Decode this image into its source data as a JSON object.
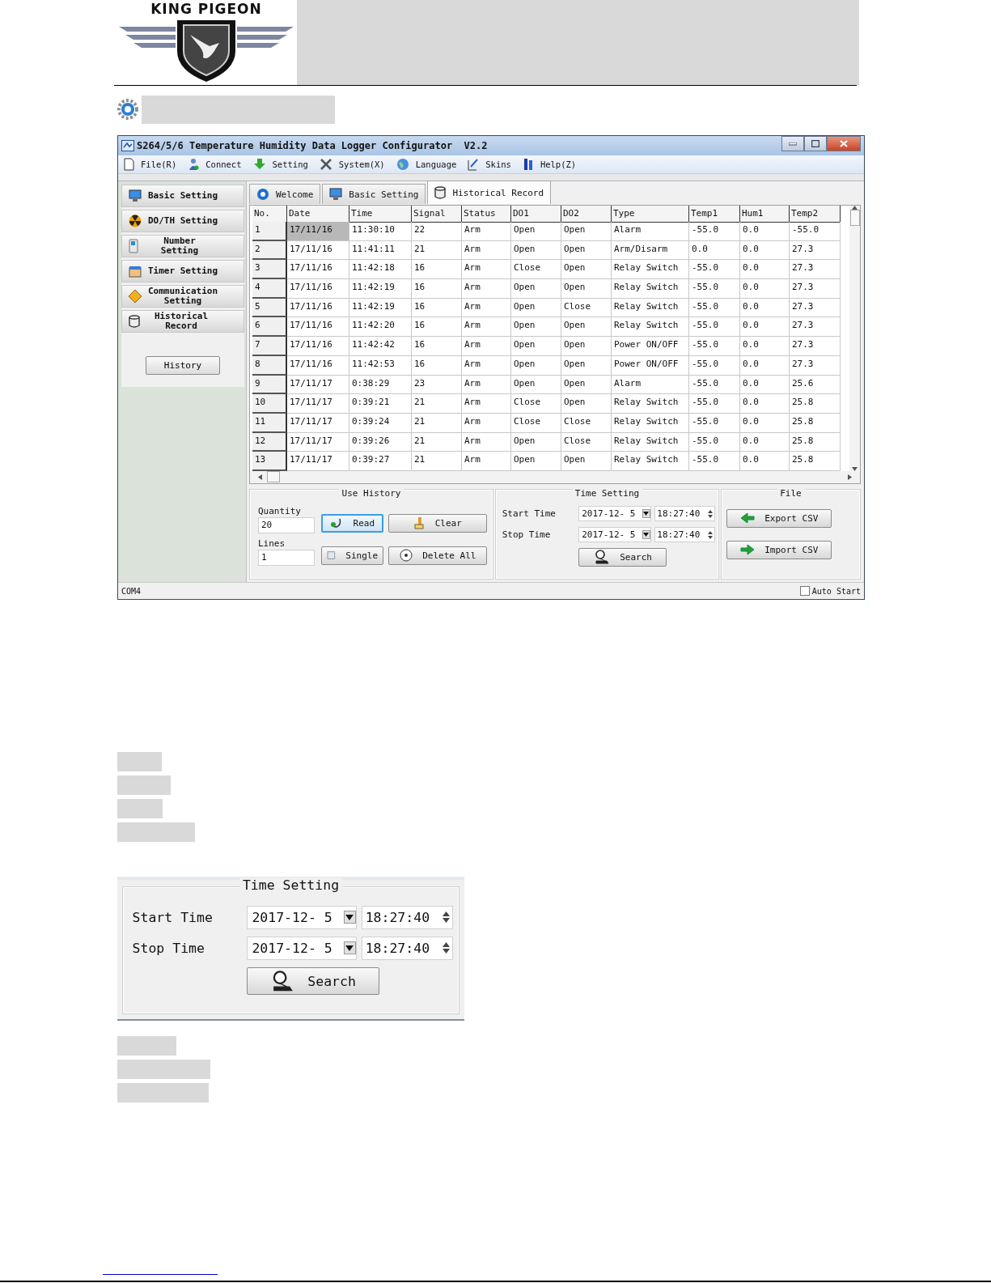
{
  "header": {
    "logo_text": "KING PIGEON"
  },
  "window": {
    "title": "S264/5/6 Temperature Humidity Data Logger Configurator  V2.2",
    "menu": [
      "File(R)",
      "Connect",
      "Setting",
      "System(X)",
      "Language",
      "Skins",
      "Help(Z)"
    ],
    "sidebar": {
      "items": [
        {
          "label": "Basic Setting"
        },
        {
          "label": "DO/TH Setting"
        },
        {
          "label": "Number Setting"
        },
        {
          "label": "Timer Setting"
        },
        {
          "label": "Communication Setting"
        },
        {
          "label": "Historical Record"
        }
      ],
      "history_button": "History"
    },
    "tabs": [
      {
        "label": "Welcome",
        "selected": false
      },
      {
        "label": "Basic Setting",
        "selected": false
      },
      {
        "label": "Historical Record",
        "selected": true
      }
    ],
    "table": {
      "columns": [
        "No.",
        "Date",
        "Time",
        "Signal",
        "Status",
        "DO1",
        "DO2",
        "Type",
        "Temp1",
        "Hum1",
        "Temp2"
      ],
      "rows": [
        {
          "selected": true,
          "cells": [
            "1",
            "17/11/16",
            "11:30:10",
            "22",
            "Arm",
            "Open",
            "Open",
            "Alarm",
            "-55.0",
            "0.0",
            "-55.0"
          ]
        },
        {
          "selected": false,
          "cells": [
            "2",
            "17/11/16",
            "11:41:11",
            "21",
            "Arm",
            "Open",
            "Open",
            "Arm/Disarm",
            "0.0",
            "0.0",
            "27.3"
          ]
        },
        {
          "selected": false,
          "cells": [
            "3",
            "17/11/16",
            "11:42:18",
            "16",
            "Arm",
            "Close",
            "Open",
            "Relay Switch",
            "-55.0",
            "0.0",
            "27.3"
          ]
        },
        {
          "selected": false,
          "cells": [
            "4",
            "17/11/16",
            "11:42:19",
            "16",
            "Arm",
            "Open",
            "Open",
            "Relay Switch",
            "-55.0",
            "0.0",
            "27.3"
          ]
        },
        {
          "selected": false,
          "cells": [
            "5",
            "17/11/16",
            "11:42:19",
            "16",
            "Arm",
            "Open",
            "Close",
            "Relay Switch",
            "-55.0",
            "0.0",
            "27.3"
          ]
        },
        {
          "selected": false,
          "cells": [
            "6",
            "17/11/16",
            "11:42:20",
            "16",
            "Arm",
            "Open",
            "Open",
            "Relay Switch",
            "-55.0",
            "0.0",
            "27.3"
          ]
        },
        {
          "selected": false,
          "cells": [
            "7",
            "17/11/16",
            "11:42:42",
            "16",
            "Arm",
            "Open",
            "Open",
            "Power ON/OFF",
            "-55.0",
            "0.0",
            "27.3"
          ]
        },
        {
          "selected": false,
          "cells": [
            "8",
            "17/11/16",
            "11:42:53",
            "16",
            "Arm",
            "Open",
            "Open",
            "Power ON/OFF",
            "-55.0",
            "0.0",
            "27.3"
          ]
        },
        {
          "selected": false,
          "cells": [
            "9",
            "17/11/17",
            "0:38:29",
            "23",
            "Arm",
            "Open",
            "Open",
            "Alarm",
            "-55.0",
            "0.0",
            "25.6"
          ]
        },
        {
          "selected": false,
          "cells": [
            "10",
            "17/11/17",
            "0:39:21",
            "21",
            "Arm",
            "Close",
            "Open",
            "Relay Switch",
            "-55.0",
            "0.0",
            "25.8"
          ]
        },
        {
          "selected": false,
          "cells": [
            "11",
            "17/11/17",
            "0:39:24",
            "21",
            "Arm",
            "Close",
            "Close",
            "Relay Switch",
            "-55.0",
            "0.0",
            "25.8"
          ]
        },
        {
          "selected": false,
          "cells": [
            "12",
            "17/11/17",
            "0:39:26",
            "21",
            "Arm",
            "Open",
            "Close",
            "Relay Switch",
            "-55.0",
            "0.0",
            "25.8"
          ]
        },
        {
          "selected": false,
          "cells": [
            "13",
            "17/11/17",
            "0:39:27",
            "21",
            "Arm",
            "Open",
            "Open",
            "Relay Switch",
            "-55.0",
            "0.0",
            "25.8"
          ]
        }
      ]
    },
    "use_history": {
      "title": "Use History",
      "quantity_label": "Quantity",
      "quantity_value": "20",
      "lines_label": "Lines",
      "lines_value": "1",
      "buttons": [
        {
          "label": "Read",
          "focused": true
        },
        {
          "label": "Clear",
          "focused": false
        },
        {
          "label": "Single",
          "focused": false
        },
        {
          "label": "Delete All",
          "focused": false
        }
      ]
    },
    "time_setting": {
      "title": "Time Setting",
      "rows": [
        {
          "label": "Start Time",
          "date": "2017-12- 5",
          "time": "18:27:40"
        },
        {
          "label": "Stop Time",
          "date": "2017-12- 5",
          "time": "18:27:40"
        }
      ],
      "search_button": "Search"
    },
    "file": {
      "title": "File",
      "buttons": [
        "Export CSV",
        "Import CSV"
      ]
    },
    "status_bar": {
      "port": "COM4",
      "auto_start": {
        "label": "Auto Start",
        "checked": false
      }
    }
  },
  "time_setting_closeup": {
    "title": "Time Setting",
    "rows": [
      {
        "label": "Start Time",
        "date": "2017-12- 5",
        "time": "18:27:40"
      },
      {
        "label": "Stop Time",
        "date": "2017-12- 5",
        "time": "18:27:40"
      }
    ],
    "search_button": "Search"
  }
}
